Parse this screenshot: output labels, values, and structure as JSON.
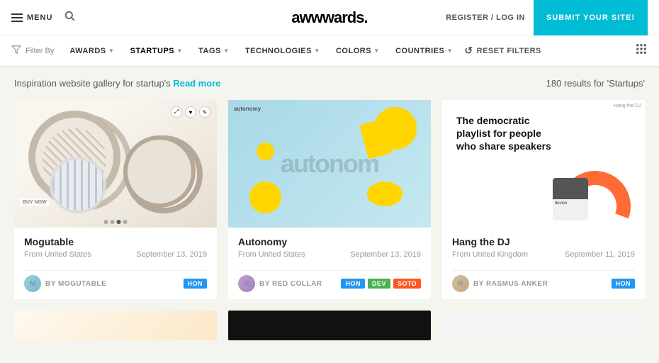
{
  "header": {
    "menu_label": "MENU",
    "logo": "awwwards.",
    "register_login": "REGISTER / LOG IN",
    "submit_label": "SUBMIT YOUR SITE!"
  },
  "filter_bar": {
    "filter_by": "Filter By",
    "items": [
      {
        "label": "AWARDS",
        "has_arrow": true
      },
      {
        "label": "STARTUPS",
        "has_arrow": true,
        "active": true
      },
      {
        "label": "TAGS",
        "has_arrow": true
      },
      {
        "label": "TECHNOLOGIES",
        "has_arrow": true
      },
      {
        "label": "COLORS",
        "has_arrow": true
      },
      {
        "label": "COUNTRIES",
        "has_arrow": true
      }
    ],
    "reset_label": "RESET FILTERS"
  },
  "results": {
    "prefix": "Inspiration website gallery for startup's",
    "read_more": "Read more",
    "count": "180",
    "suffix": "results for 'Startups'"
  },
  "cards": [
    {
      "title": "Mogutable",
      "origin": "From United States",
      "date": "September 13, 2019",
      "author": "BY MOGUTABLE",
      "badges": [
        "HON"
      ]
    },
    {
      "title": "Autonomy",
      "origin": "From United States",
      "date": "September 13, 2019",
      "author": "BY RED COLLAR",
      "badges": [
        "HON",
        "DEV",
        "SOTD"
      ]
    },
    {
      "title": "Hang the DJ",
      "origin": "From United Kingdom",
      "date": "September 11, 2019",
      "author": "BY RASMUS ANKER",
      "badges": [
        "HON"
      ]
    }
  ],
  "colors": {
    "accent": "#00bcd4",
    "badge_hon": "#2196f3",
    "badge_dev": "#4caf50",
    "badge_sotd": "#ff5722"
  }
}
